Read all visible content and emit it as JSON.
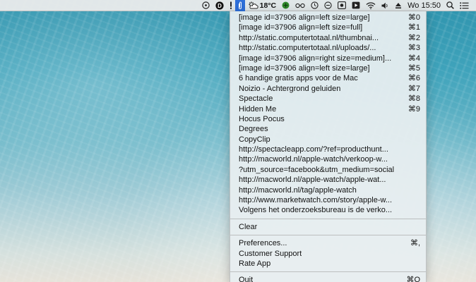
{
  "menubar": {
    "temperature": "18°C",
    "clock": "Wo 15:50",
    "icons": [
      "dashboard-icon",
      "d-app-icon",
      "clipboard-app-icon",
      "weather-icon",
      "green-circle-icon",
      "glasses-icon",
      "clock-icon",
      "circle-icon",
      "record-icon",
      "media-icon",
      "wifi-icon",
      "volume-icon",
      "eject-icon",
      "spotlight-search-icon",
      "list-menu-icon"
    ]
  },
  "menu": {
    "history": [
      {
        "label": "[image id=37906 align=left size=large]",
        "shortcut": "⌘0"
      },
      {
        "label": "[image id=37906 align=left size=full]",
        "shortcut": "⌘1"
      },
      {
        "label": "http://static.computertotaal.nl/thumbnai...",
        "shortcut": "⌘2"
      },
      {
        "label": "http://static.computertotaal.nl/uploads/...",
        "shortcut": "⌘3"
      },
      {
        "label": "[image id=37906 align=right size=medium]...",
        "shortcut": "⌘4"
      },
      {
        "label": "[image id=37906 align=left size=large]",
        "shortcut": "⌘5"
      },
      {
        "label": "6 handige gratis apps voor de Mac",
        "shortcut": "⌘6"
      },
      {
        "label": "Noizio - Achtergrond geluiden",
        "shortcut": "⌘7"
      },
      {
        "label": "Spectacle",
        "shortcut": "⌘8"
      },
      {
        "label": "Hidden Me",
        "shortcut": "⌘9"
      },
      {
        "label": "Hocus Pocus",
        "shortcut": ""
      },
      {
        "label": "Degrees",
        "shortcut": ""
      },
      {
        "label": "CopyClip",
        "shortcut": ""
      },
      {
        "label": "http://spectacleapp.com/?ref=producthunt...",
        "shortcut": ""
      },
      {
        "label": "http://macworld.nl/apple-watch/verkoop-w...",
        "shortcut": ""
      },
      {
        "label": "?utm_source=facebook&utm_medium=social_u...",
        "shortcut": ""
      },
      {
        "label": "http://macworld.nl/apple-watch/apple-wat...",
        "shortcut": ""
      },
      {
        "label": "http://macworld.nl/tag/apple-watch",
        "shortcut": ""
      },
      {
        "label": "http://www.marketwatch.com/story/apple-w...",
        "shortcut": ""
      },
      {
        "label": "Volgens het onderzoeksbureau is de verko...",
        "shortcut": ""
      }
    ],
    "clear": "Clear",
    "preferences": {
      "label": "Preferences...",
      "shortcut": "⌘,"
    },
    "support": "Customer Support",
    "rate": "Rate App",
    "quit": {
      "label": "Quit",
      "shortcut": "⌘Q"
    }
  },
  "colors": {
    "menubar_bg": "#ececec",
    "active_highlight": "#2e6fd8",
    "menu_bg": "#e8eef0"
  }
}
